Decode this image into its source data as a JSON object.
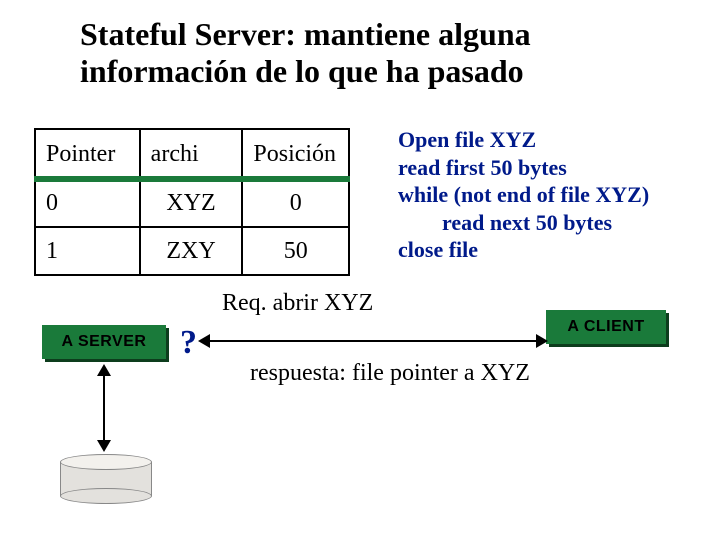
{
  "title": "Stateful Server: mantiene alguna información de lo que ha pasado",
  "table": {
    "headers": {
      "pointer": "Pointer",
      "archi": "archi",
      "posicion": "Posición"
    },
    "rows": [
      {
        "pointer": "0",
        "archi": "XYZ",
        "posicion": "0"
      },
      {
        "pointer": "1",
        "archi": "ZXY",
        "posicion": "50"
      }
    ]
  },
  "pseudocode": "Open file XYZ\nread first 50 bytes\nwhile (not end of file XYZ)\n        read next 50 bytes\nclose file",
  "labels": {
    "request": "Req. abrir XYZ",
    "response": "respuesta: file pointer a XYZ",
    "server": "A SERVER",
    "client": "A CLIENT",
    "question": "?"
  }
}
